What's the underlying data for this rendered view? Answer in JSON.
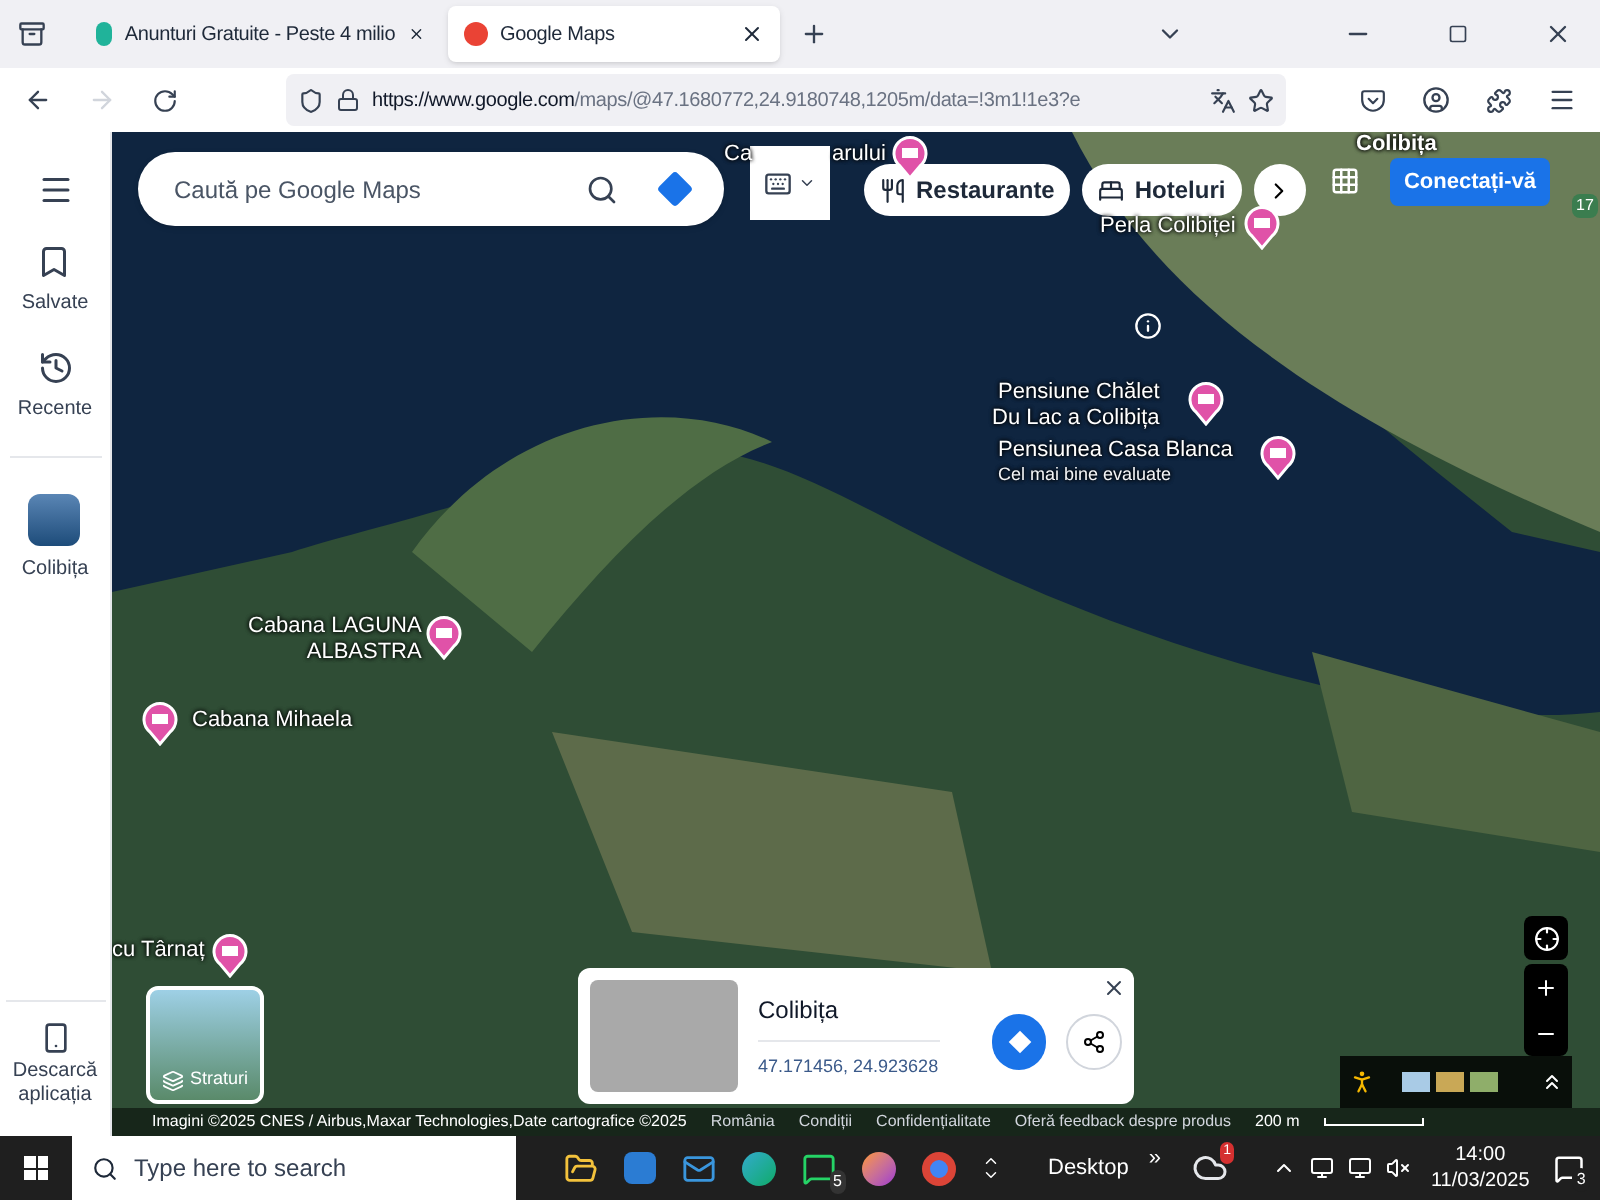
{
  "browser": {
    "tabs": [
      {
        "title": "Anunturi Gratuite - Peste 4 milio",
        "selected": false
      },
      {
        "title": "Google Maps",
        "selected": true
      }
    ],
    "url": {
      "host": "https://www.google.com",
      "path": "/maps/@47.1680772,24.9180748,1205m/data=!3m1!1e3?e"
    }
  },
  "sidebar": {
    "items": [
      {
        "kind": "saved",
        "label": "Salvate"
      },
      {
        "kind": "recent",
        "label": "Recente"
      },
      {
        "kind": "place",
        "label": "Colibița"
      }
    ],
    "download": "Descarcă aplicația"
  },
  "search": {
    "placeholder": "Caută pe Google Maps"
  },
  "chips": [
    "Restaurante",
    "Hoteluri"
  ],
  "sign_in": "Conectați-vă",
  "map": {
    "town": "Colibița",
    "road": "17",
    "places": [
      {
        "lines": [
          "Ca"
        ]
      },
      {
        "lines": [
          "arului"
        ]
      },
      {
        "lines": [
          "Perla Colibiței"
        ]
      },
      {
        "lines": [
          "Pensiune Chălet",
          "Du Lac a Colibița"
        ]
      },
      {
        "lines": [
          "Pensiunea Casa Blanca"
        ],
        "note": "Cel mai bine evaluate"
      },
      {
        "lines": [
          "Cabana LAGUNA",
          "ALBASTRA"
        ]
      },
      {
        "lines": [
          "Cabana Mihaela"
        ]
      },
      {
        "lines": [
          "cu Târnaț"
        ]
      }
    ],
    "layers": "Straturi"
  },
  "place_card": {
    "title": "Colibița",
    "coords": "47.171456, 24.923628"
  },
  "footer": {
    "attribution": "Imagini ©2025 CNES / Airbus,Maxar Technologies,Date cartografice ©2025",
    "links": [
      "România",
      "Condiții",
      "Confidențialitate",
      "Oferă feedback despre produs"
    ],
    "scale": "200 m"
  },
  "taskbar": {
    "search_placeholder": "Type here to search",
    "whatsapp_badge": "5",
    "desktop": "Desktop",
    "more": "»",
    "weather_badge": "1",
    "time": "14:00",
    "date": "11/03/2025",
    "notifications": "3"
  }
}
